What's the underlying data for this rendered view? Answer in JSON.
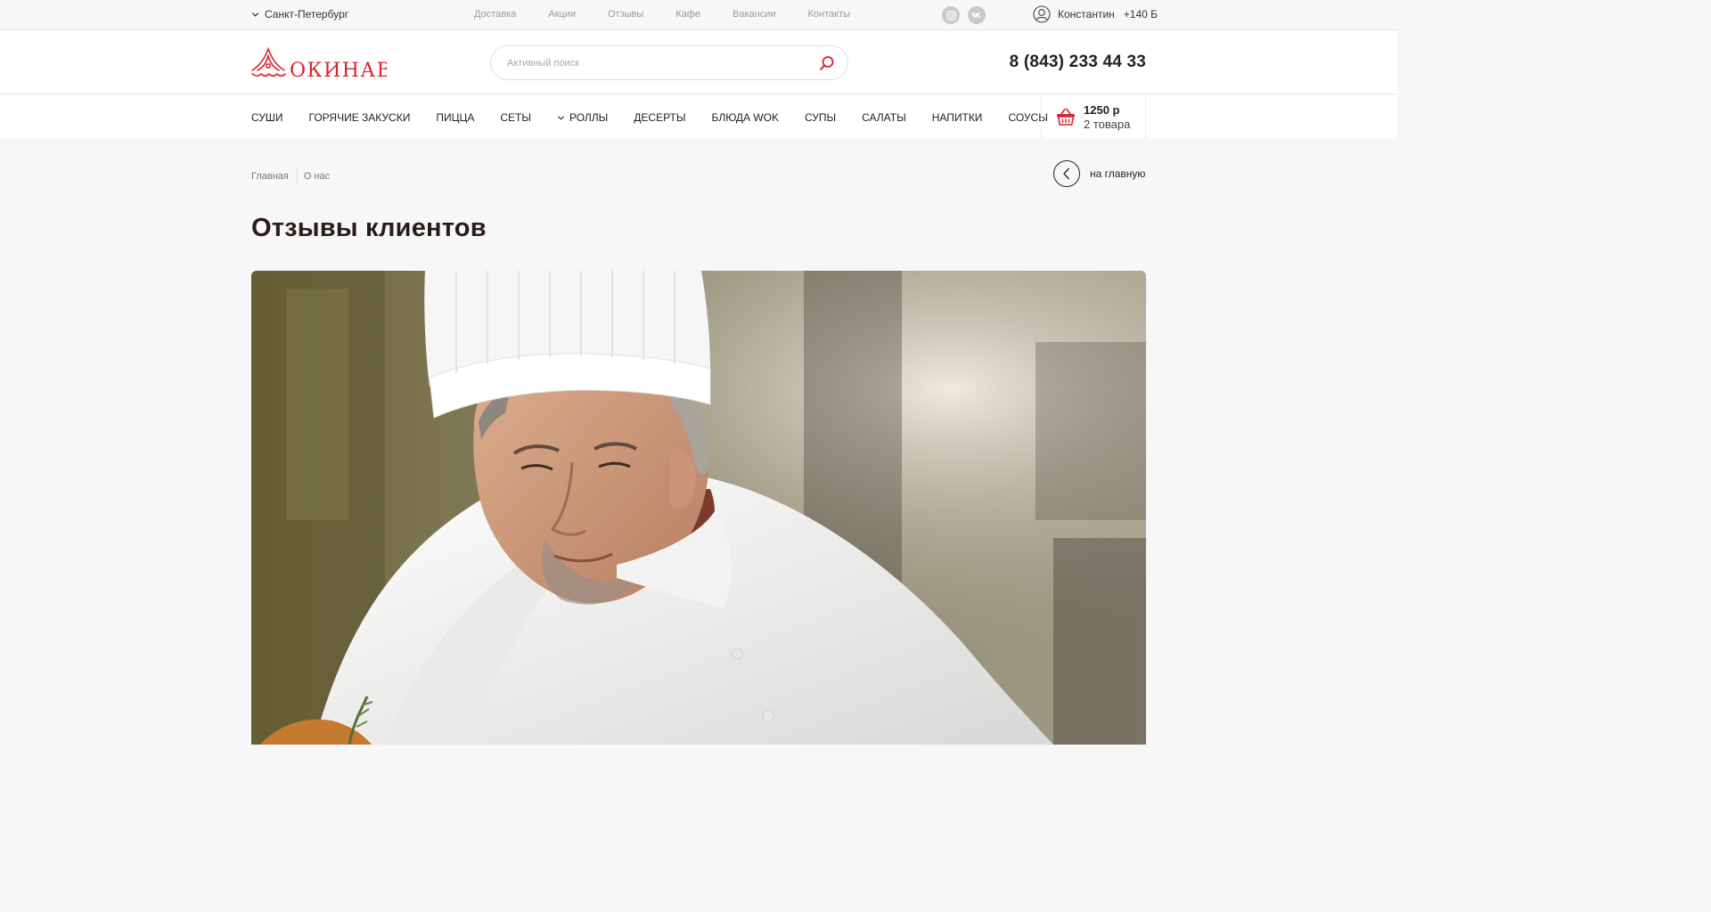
{
  "topbar": {
    "city": "Санкт-Петербург",
    "links": [
      {
        "label": "Доставка"
      },
      {
        "label": "Акции"
      },
      {
        "label": "Отзывы"
      },
      {
        "label": "Кафе"
      },
      {
        "label": "Вакансии"
      },
      {
        "label": "Контакты"
      }
    ],
    "social": [
      {
        "icon": "instagram-icon"
      },
      {
        "icon": "vk-icon"
      }
    ],
    "user": {
      "name": "Константин",
      "bonus": "+140 Б",
      "icon": "user-icon"
    }
  },
  "header": {
    "logo_text": "ОКИНАВА",
    "search_placeholder": "Активный поиск",
    "phone": "8 (843) 233 44 33"
  },
  "categories": [
    {
      "label": "СУШИ"
    },
    {
      "label": "ГОРЯЧИЕ ЗАКУСКИ"
    },
    {
      "label": "ПИЦЦА"
    },
    {
      "label": "СЕТЫ"
    },
    {
      "label": "РОЛЛЫ",
      "dropdown": true
    },
    {
      "label": "ДЕСЕРТЫ"
    },
    {
      "label": "БЛЮДА WOK"
    },
    {
      "label": "СУПЫ"
    },
    {
      "label": "САЛАТЫ"
    },
    {
      "label": "НАПИТКИ"
    },
    {
      "label": "СОУСЫ"
    }
  ],
  "cart": {
    "sum": "1250 р",
    "count": "2 товара",
    "icon": "basket-icon"
  },
  "breadcrumbs": [
    {
      "label": "Главная"
    },
    {
      "label": "О нас"
    }
  ],
  "back": {
    "label": "на главную",
    "icon": "chevron-left-icon"
  },
  "page": {
    "title": "Отзывы клиентов"
  },
  "colors": {
    "accent": "#d9232d",
    "text": "#222222",
    "muted": "#9a9a9a",
    "background": "#f7f7f7"
  }
}
